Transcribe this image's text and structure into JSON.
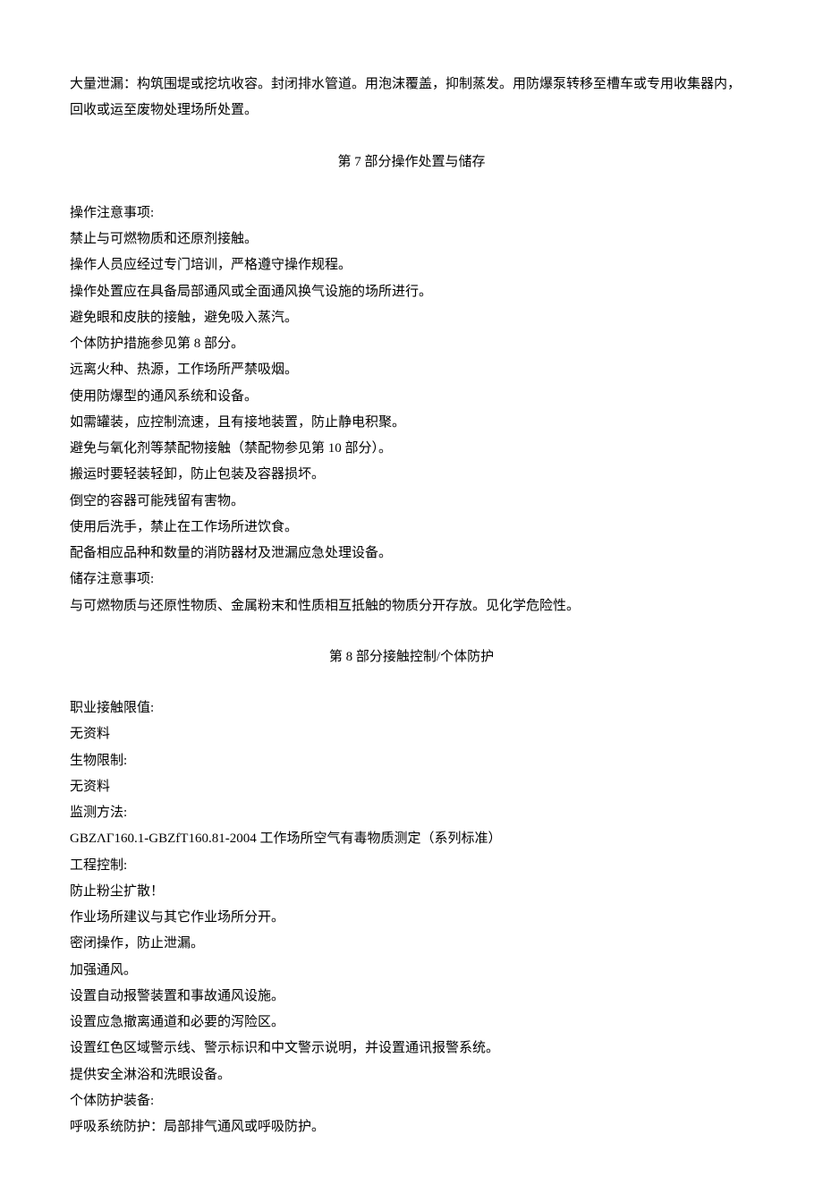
{
  "intro": "大量泄漏：构筑围堤或挖坑收容。封闭排水管道。用泡沫覆盖，抑制蒸发。用防爆泵转移至槽车或专用收集器内，回收或运至废物处理场所处置。",
  "section7": {
    "title": "第 7 部分操作处置与储存",
    "lines": [
      "操作注意事项:",
      "禁止与可燃物质和还原剂接触。",
      "操作人员应经过专门培训，严格遵守操作规程。",
      "操作处置应在具备局部通风或全面通风换气设施的场所进行。",
      "避免眼和皮肤的接触，避免吸入蒸汽。",
      "个体防护措施参见第 8 部分。",
      "远离火种、热源，工作场所严禁吸烟。",
      "使用防爆型的通风系统和设备。",
      "如需罐装，应控制流速，且有接地装置，防止静电积聚。",
      "避免与氧化剂等禁配物接触（禁配物参见第 10 部分）。",
      "搬运时要轻装轻卸，防止包装及容器损坏。",
      "倒空的容器可能残留有害物。",
      "使用后洗手，禁止在工作场所进饮食。",
      "配备相应品种和数量的消防器材及泄漏应急处理设备。",
      "储存注意事项:",
      "与可燃物质与还原性物质、金属粉末和性质相互抵触的物质分开存放。见化学危险性。"
    ]
  },
  "section8": {
    "title": "第 8 部分接触控制/个体防护",
    "lines": [
      "职业接触限值:",
      "无资料",
      "生物限制:",
      "无资料",
      "监测方法:",
      "GBZΛΓ160.1-GBZfT160.81-2004 工作场所空气有毒物质测定（系列标准）",
      "工程控制:",
      "防止粉尘扩散！",
      "作业场所建议与其它作业场所分开。",
      "密闭操作，防止泄漏。",
      "加强通风。",
      "设置自动报警装置和事故通风设施。",
      "设置应急撤离通道和必要的泻险区。",
      "设置红色区域警示线、警示标识和中文警示说明，并设置通讯报警系统。",
      "提供安全淋浴和洗眼设备。",
      "个体防护装备:",
      "呼吸系统防护：局部排气通风或呼吸防护。"
    ]
  }
}
